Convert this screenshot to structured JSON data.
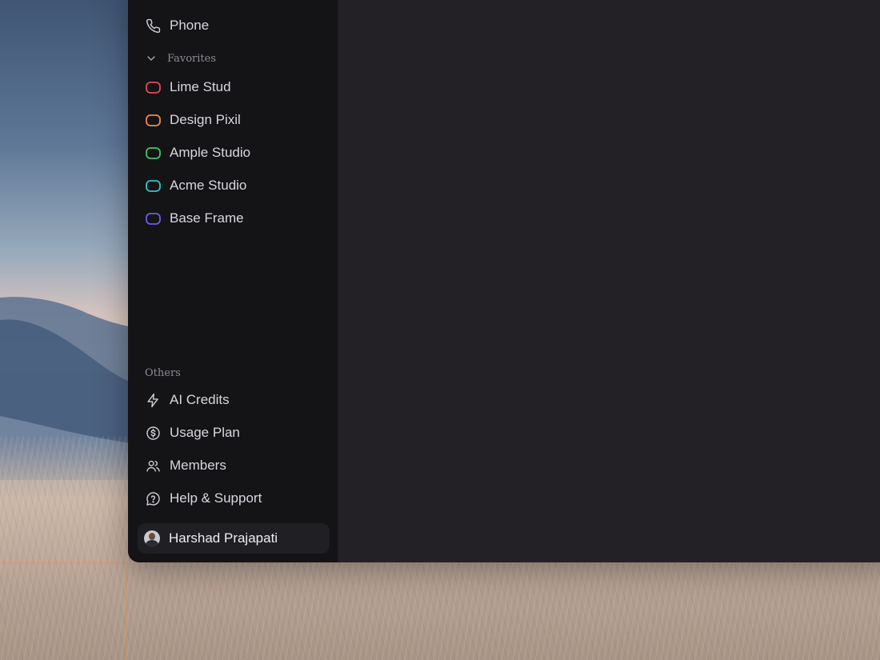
{
  "sidebar": {
    "nav": [
      {
        "label": "Phone",
        "icon": "phone-icon"
      }
    ],
    "favorites": {
      "heading": "Favorites",
      "items": [
        {
          "label": "Lime Stud",
          "color": "#e2495b"
        },
        {
          "label": "Design Pixil",
          "color": "#f08c4a"
        },
        {
          "label": "Ample Studio",
          "color": "#43c463"
        },
        {
          "label": "Acme Studio",
          "color": "#2fc7c9"
        },
        {
          "label": "Base Frame",
          "color": "#6a5cf0"
        }
      ]
    },
    "others": {
      "heading": "Others",
      "items": [
        {
          "label": "AI Credits",
          "icon": "lightning-icon"
        },
        {
          "label": "Usage Plan",
          "icon": "dollar-circle-icon"
        },
        {
          "label": "Members",
          "icon": "users-icon"
        },
        {
          "label": "Help & Support",
          "icon": "help-circle-icon"
        }
      ]
    },
    "user": {
      "name": "Harshad Prajapati"
    }
  }
}
